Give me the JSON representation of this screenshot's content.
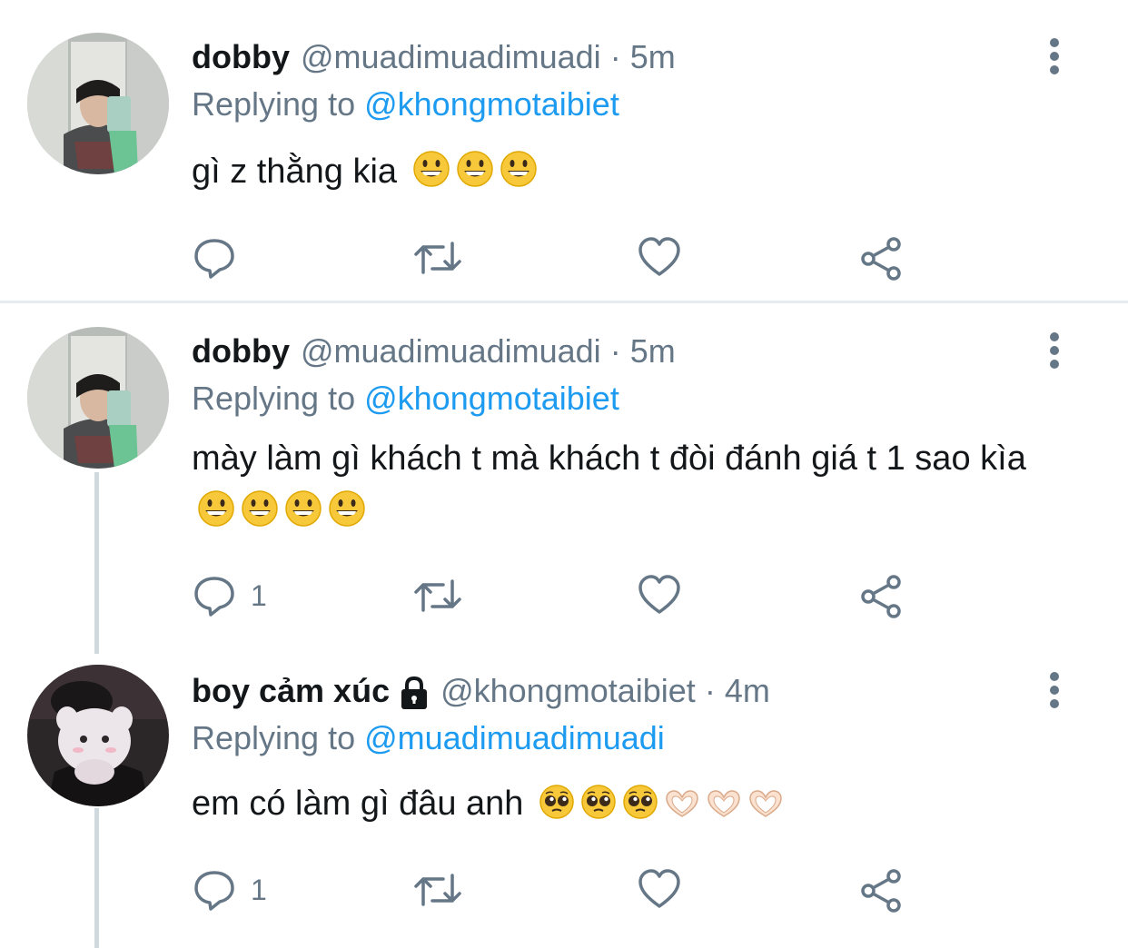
{
  "tweets": [
    {
      "display_name": "dobby",
      "handle": "@muadimuadimuadi",
      "separator": "·",
      "time": "5m",
      "replying_label": "Replying to",
      "replying_to": "@khongmotaibiet",
      "text": "gì z thằng kia",
      "emojis": [
        "grinning-face",
        "grinning-face",
        "grinning-face"
      ],
      "reply_count": "",
      "locked": false
    },
    {
      "display_name": "dobby",
      "handle": "@muadimuadimuadi",
      "separator": "·",
      "time": "5m",
      "replying_label": "Replying to",
      "replying_to": "@khongmotaibiet",
      "text": "mày làm gì khách t mà khách t đòi đánh giá t 1 sao kìa",
      "emojis": [
        "grinning-face",
        "grinning-face",
        "grinning-face",
        "grinning-face"
      ],
      "reply_count": "1",
      "locked": false
    },
    {
      "display_name": "boy cảm xúc",
      "handle": "@khongmotaibiet",
      "separator": "·",
      "time": "4m",
      "replying_label": "Replying to",
      "replying_to": "@muadimuadimuadi",
      "text": "em có làm gì đâu anh",
      "emojis": [
        "pleading-face",
        "pleading-face",
        "pleading-face",
        "heart-hands",
        "heart-hands",
        "heart-hands"
      ],
      "reply_count": "1",
      "locked": true
    }
  ],
  "icons": {
    "reply": "reply-icon",
    "retweet": "retweet-icon",
    "like": "heart-icon",
    "share": "share-icon",
    "more": "more-vertical-icon",
    "lock": "lock-icon"
  },
  "colors": {
    "link": "#1d9bf0",
    "muted": "#657786",
    "text": "#14171a",
    "divider": "#e6ecf0",
    "thread_line": "#cfd9de"
  }
}
